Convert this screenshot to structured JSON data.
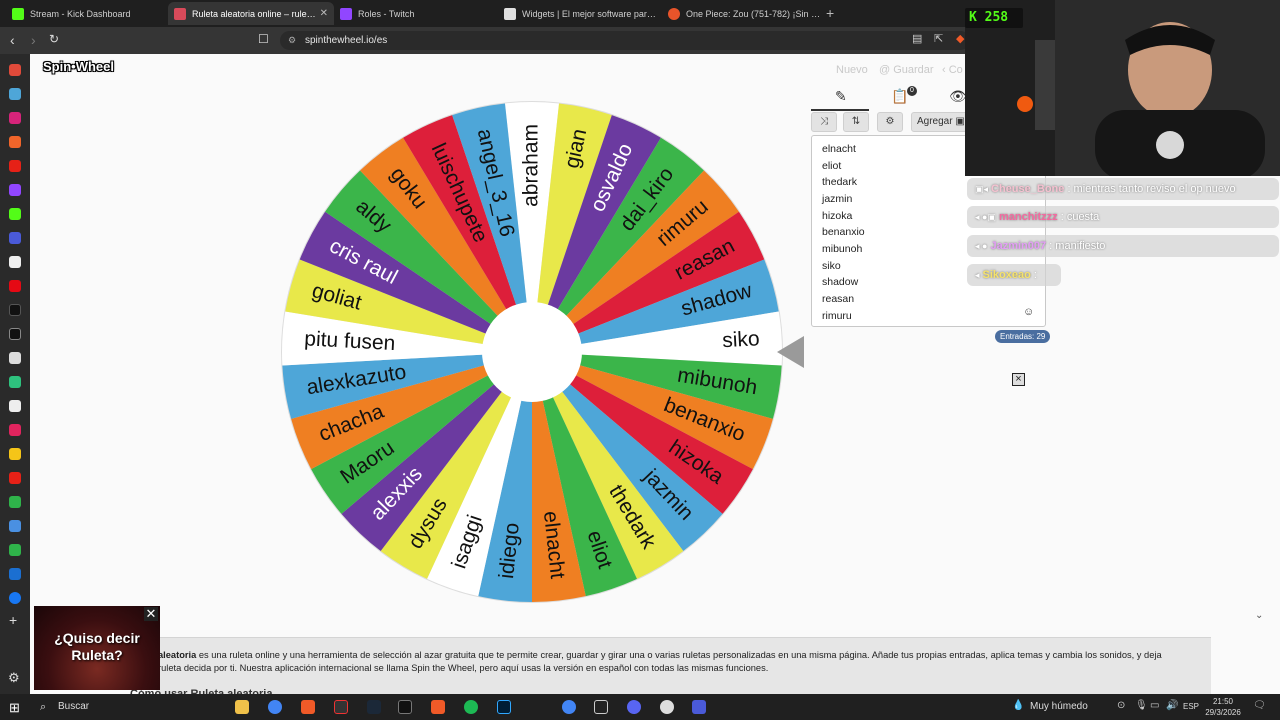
{
  "browser": {
    "tabs": [
      {
        "title": "Stream - Kick Dashboard",
        "color": "#53fc18"
      },
      {
        "title": "Ruleta aleatoria online – ruleta d",
        "color": "#d94a5a",
        "active": true
      },
      {
        "title": "Roles - Twitch",
        "color": "#9146ff"
      },
      {
        "title": "Widgets | El mejor software para pot",
        "color": "#e0e0e0"
      },
      {
        "title": "One Piece: Zou (751-782) ¡Sin salida!",
        "color": "#e8542a"
      }
    ],
    "new_tab": "+",
    "url": "spinthewheel.io/es"
  },
  "page": {
    "logo": "Spin•Wheel",
    "links": {
      "nuevo": "Nuevo",
      "guardar": "@ Guardar",
      "compartir": "‹ Co"
    }
  },
  "wheel": {
    "segments": [
      {
        "label": "abraham",
        "color": "#ffffff"
      },
      {
        "label": "gian",
        "color": "#e8e84a"
      },
      {
        "label": "osvaldo",
        "color": "#6b3aa0"
      },
      {
        "label": "dai_kiro",
        "color": "#3bb54a"
      },
      {
        "label": "rimuru",
        "color": "#ef7f22"
      },
      {
        "label": "reasan",
        "color": "#dd1f3a"
      },
      {
        "label": "shadow",
        "color": "#4ea6d8"
      },
      {
        "label": "siko",
        "color": "#ffffff"
      },
      {
        "label": "mibunoh",
        "color": "#3bb54a"
      },
      {
        "label": "benanxio",
        "color": "#ef7f22"
      },
      {
        "label": "hizoka",
        "color": "#dd1f3a"
      },
      {
        "label": "jazmin",
        "color": "#4ea6d8"
      },
      {
        "label": "thedark",
        "color": "#e8e84a"
      },
      {
        "label": "eliot",
        "color": "#3bb54a"
      },
      {
        "label": "elnacht",
        "color": "#ef7f22"
      },
      {
        "label": "idiego",
        "color": "#4ea6d8"
      },
      {
        "label": "isaggi",
        "color": "#ffffff"
      },
      {
        "label": "dysus",
        "color": "#e8e84a"
      },
      {
        "label": "alexxis",
        "color": "#6b3aa0"
      },
      {
        "label": "Maoru",
        "color": "#3bb54a"
      },
      {
        "label": "chacha",
        "color": "#ef7f22"
      },
      {
        "label": "alexkazuto",
        "color": "#4ea6d8"
      },
      {
        "label": "pitu fusen",
        "color": "#ffffff"
      },
      {
        "label": "goliat",
        "color": "#e8e84a"
      },
      {
        "label": "cris raul",
        "color": "#6b3aa0"
      },
      {
        "label": "aldy",
        "color": "#3bb54a"
      },
      {
        "label": "goku",
        "color": "#ef7f22"
      },
      {
        "label": "luischupete",
        "color": "#dd1f3a"
      },
      {
        "label": "angel_3_16",
        "color": "#4ea6d8"
      }
    ]
  },
  "panel": {
    "add_label": "Agregar",
    "results_badge": "0",
    "entries": [
      "elnacht",
      "eliot",
      "thedark",
      "jazmin",
      "hizoka",
      "benanxio",
      "mibunoh",
      "siko",
      "shadow",
      "reasan",
      "rimuru"
    ],
    "entries_count": "Entradas: 29",
    "close_symbol": "×"
  },
  "description": {
    "bold": "aleatoria",
    "text": " es una ruleta online y una herramienta de selección al azar gratuita que te permite crear, guardar y girar una o varias ruletas personalizadas en una misma página. Añade tus propias entradas, aplica temas y cambia los sonidos, y deja",
    "line2": "ruleta decida por ti. Nuestra aplicación internacional se llama Spin the Wheel, pero aquí usas la versión en español con todas las mismas funciones.",
    "heading": "Cómo usar Ruleta aleatoria"
  },
  "ad": {
    "text": "¿Quiso decir Ruleta?"
  },
  "stream": {
    "viewers": "258",
    "chat": [
      {
        "user": "Cheuse_Bone",
        "message": " : mientras tanto reviso el op nuevo",
        "user_color": "#f5c1d0"
      },
      {
        "user": "manchitzzz",
        "message": " : cuesta",
        "user_color": "#f46aa0"
      },
      {
        "user": "Jazmin007",
        "message": " : manifiesto",
        "user_color": "#e39df5"
      },
      {
        "user": "Sikoxeao",
        "message": " : ",
        "user_color": "#f5e26a"
      }
    ]
  },
  "taskbar": {
    "search_placeholder": "Buscar",
    "weather": "Muy húmedo",
    "lang": "ESP",
    "time": "21:50",
    "date": "29/3/2026"
  }
}
